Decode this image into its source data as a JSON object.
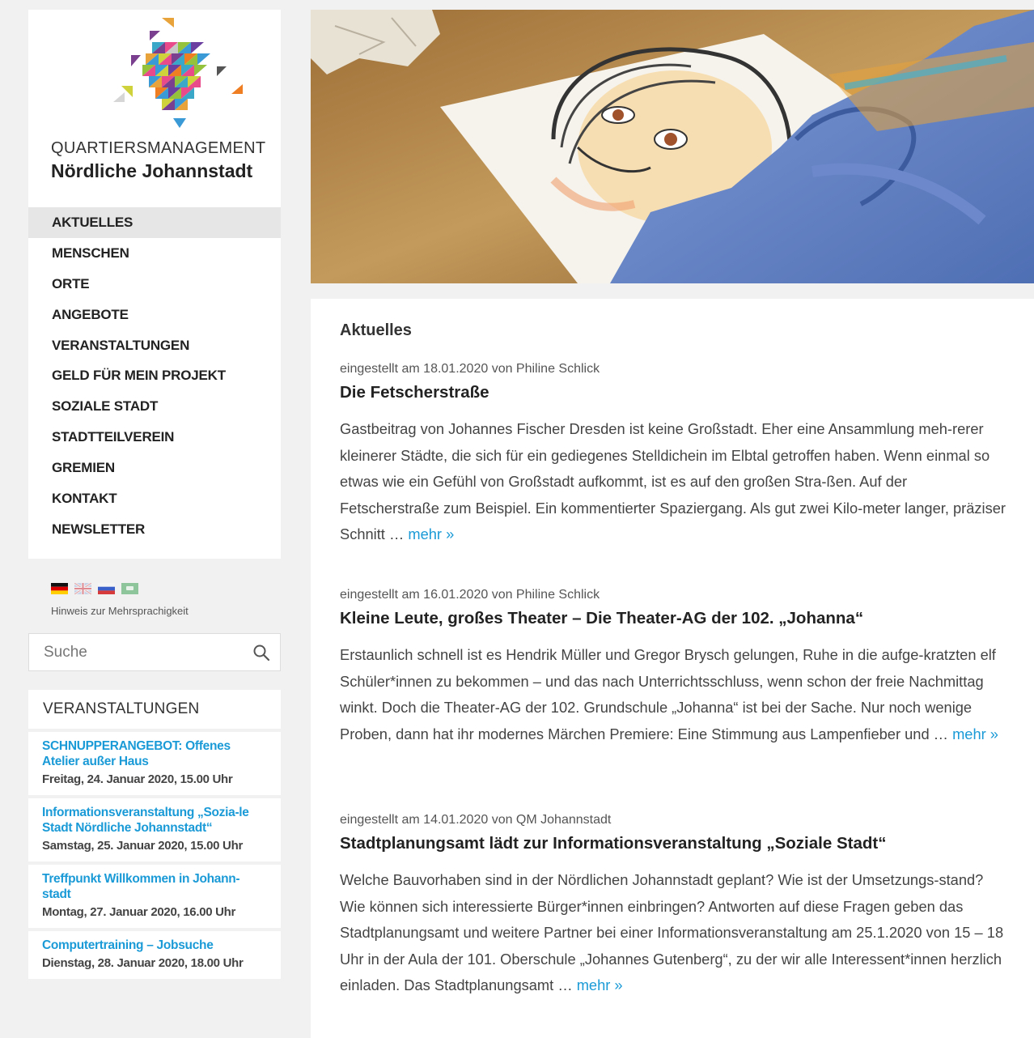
{
  "site": {
    "logo_line1": "QUARTIERSMANAGEMENT",
    "logo_line2": "Nördliche Johannstadt"
  },
  "nav": {
    "items": [
      {
        "label": "AKTUELLES",
        "active": true
      },
      {
        "label": "MENSCHEN"
      },
      {
        "label": "ORTE"
      },
      {
        "label": "ANGEBOTE"
      },
      {
        "label": "VERANSTALTUNGEN"
      },
      {
        "label": "GELD FÜR MEIN PROJEKT"
      },
      {
        "label": "SOZIALE STADT"
      },
      {
        "label": "STADTTEILVEREIN"
      },
      {
        "label": "GREMIEN"
      },
      {
        "label": "KONTAKT"
      },
      {
        "label": "NEWSLETTER"
      }
    ]
  },
  "language": {
    "flags": [
      "german-flag-icon",
      "uk-flag-icon",
      "russian-flag-icon",
      "arabic-flag-icon"
    ],
    "hint": "Hinweis zur Mehrsprachigkeit"
  },
  "search": {
    "placeholder": "Suche"
  },
  "events": {
    "heading": "VERANSTALTUNGEN",
    "items": [
      {
        "title": "SCHNUPPERANGEBOT: Offenes Atelier außer Haus",
        "date": "Freitag, 24. Januar 2020, 15.00 Uhr"
      },
      {
        "title": "Informationsveranstaltung „Sozia-le Stadt Nördliche Johannstadt“",
        "date": "Samstag, 25. Januar 2020, 15.00 Uhr"
      },
      {
        "title": "Treffpunkt Willkommen in Johann-stadt",
        "date": "Montag, 27. Januar 2020, 16.00 Uhr"
      },
      {
        "title": "Computertraining – Jobsuche",
        "date": "Dienstag, 28. Januar 2020, 18.00 Uhr"
      }
    ]
  },
  "main": {
    "title": "Aktuelles",
    "more_label": "mehr »",
    "posts": [
      {
        "meta": "eingestellt am 18.01.2020 von Philine Schlick",
        "title": "Die Fetscherstraße",
        "excerpt": "Gastbeitrag von Johannes Fischer Dresden ist keine Großstadt. Eher eine Ansammlung meh-rerer kleinerer Städte, die sich für ein gediegenes Stelldichein im Elbtal getroffen haben. Wenn einmal so etwas wie ein Gefühl von Großstadt aufkommt, ist es auf den großen Stra-ßen. Auf der Fetscherstraße zum Beispiel. Ein kommentierter Spaziergang.  Als gut zwei Kilo-meter langer, präziser Schnitt …"
      },
      {
        "meta": "eingestellt am 16.01.2020 von Philine Schlick",
        "title": "Kleine Leute, großes Theater – Die Theater-AG der 102. „Johanna“",
        "excerpt": "Erstaunlich schnell ist es Hendrik Müller und Gregor Brysch gelungen, Ruhe in die aufge-kratzten elf Schüler*innen zu bekommen – und das nach Unterrichtsschluss, wenn schon der freie Nachmittag winkt. Doch die Theater-AG der 102. Grundschule „Johanna“ ist bei der Sache. Nur noch wenige Proben, dann hat ihr modernes Märchen Premiere: Eine Stimmung aus Lampenfieber und …"
      },
      {
        "meta": "eingestellt am 14.01.2020 von QM Johannstadt",
        "title": "Stadtplanungsamt lädt zur Informationsveranstaltung „Soziale Stadt“",
        "excerpt": "Welche Bauvorhaben sind in der Nördlichen Johannstadt geplant? Wie ist der Umsetzungs-stand? Wie können sich interessierte Bürger*innen einbringen? Antworten auf diese Fragen geben das Stadtplanungsamt und weitere Partner bei einer Informationsveranstaltung am 25.1.2020 von 15 – 18 Uhr in der Aula der 101. Oberschule „Johannes Gutenberg“, zu der wir alle Interessent*innen herzlich einladen. Das Stadtplanungsamt …"
      }
    ]
  },
  "colors": {
    "accent": "#1a9ad6",
    "active_nav_bg": "#e6e6e6",
    "page_bg": "#f1f1f1"
  }
}
